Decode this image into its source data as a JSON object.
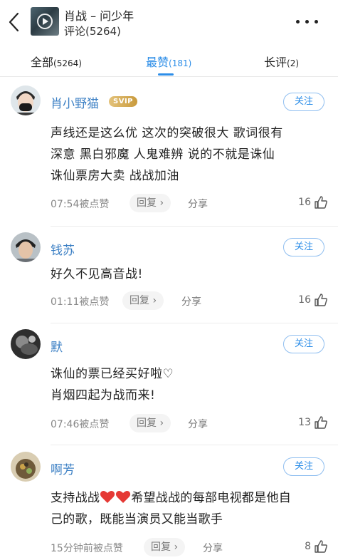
{
  "header": {
    "title": "肖战 – 问少年",
    "comment_count": "评论(5264)"
  },
  "tabs": [
    {
      "label": "全部",
      "count": "(5264)"
    },
    {
      "label": "最赞",
      "count": "(181)"
    },
    {
      "label": "长评",
      "count": "(2)"
    }
  ],
  "comments": [
    {
      "user": "肖小野猫",
      "badge": "SVIP",
      "follow": "关注",
      "lines": [
        "声线还是这么优  这次的突破很大  歌词很有",
        "深意  黑白邪魔  人鬼难辨  说的不就是诛仙",
        "诛仙票房大卖  战战加油"
      ],
      "time": "07:54被点赞",
      "reply": "回复",
      "share": "分享",
      "likes": "16"
    },
    {
      "user": "钱苏",
      "follow": "关注",
      "lines": [
        "好久不见高音战!"
      ],
      "time": "01:11被点赞",
      "reply": "回复",
      "share": "分享",
      "likes": "16"
    },
    {
      "user": "默",
      "follow": "关注",
      "lines": [
        "诛仙的票已经买好啦♡",
        "肖烟四起为战而来!"
      ],
      "time": "07:46被点赞",
      "reply": "回复",
      "share": "分享",
      "likes": "13"
    },
    {
      "user": "啊芳",
      "follow": "关注",
      "line1_before": "支持战战",
      "line1_after": "希望战战的每部电视都是他自",
      "line2": "己的歌，既能当演员又能当歌手",
      "time": "15分钟前被点赞",
      "reply": "回复",
      "share": "分享",
      "likes": "8"
    }
  ],
  "colors": {
    "accent": "#2d8ee8",
    "username": "#3b7fc4",
    "heart": "#e53935",
    "svip": "#d4a84e"
  }
}
